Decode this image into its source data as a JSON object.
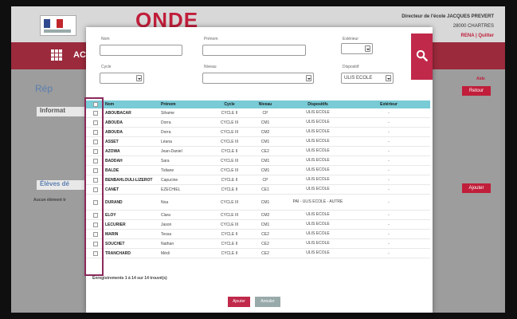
{
  "header": {
    "app_title": "ONDE",
    "director": "Directeur de l'école JACQUES PREVERT",
    "city": "28000 CHARTRES",
    "user_links": "RENA | Quitter"
  },
  "nav": {
    "label": "AC"
  },
  "background": {
    "section_title": "Rép",
    "info_title": "Informat",
    "students_title": "Élèves dé",
    "none_text": "Aucun élément tr",
    "help": "Aide",
    "back_button": "Retour",
    "add_button": "Ajouter"
  },
  "search": {
    "nom_label": "Nom",
    "nom_value": "",
    "prenom_label": "Prénom",
    "prenom_value": "",
    "exterieur_label": "Extérieur",
    "exterieur_value": "",
    "cycle_label": "Cycle",
    "cycle_value": "",
    "niveau_label": "Niveau",
    "niveau_value": "",
    "dispositif_label": "Dispositif",
    "dispositif_value": "ULIS ECOLE"
  },
  "table": {
    "headers": {
      "nom": "Nom",
      "prenom": "Prénom",
      "cycle": "Cycle",
      "niveau": "Niveau",
      "dispositifs": "Dispositifs",
      "exterieur": "Extérieur"
    },
    "rows": [
      {
        "nom": "ABOUBACAR",
        "prenom": "Sihame",
        "cycle": "CYCLE II",
        "niveau": "CP",
        "dispositifs": "ULIS ECOLE",
        "exterieur": "-"
      },
      {
        "nom": "ABOUDA",
        "prenom": "Dorra",
        "cycle": "CYCLE III",
        "niveau": "CM1",
        "dispositifs": "ULIS ECOLE",
        "exterieur": "-"
      },
      {
        "nom": "ABOUDA",
        "prenom": "Dorra",
        "cycle": "CYCLE III",
        "niveau": "CM2",
        "dispositifs": "ULIS ECOLE",
        "exterieur": "-"
      },
      {
        "nom": "ASSET",
        "prenom": "Léana",
        "cycle": "CYCLE III",
        "niveau": "CM1",
        "dispositifs": "ULIS ECOLE",
        "exterieur": "-"
      },
      {
        "nom": "AZOWA",
        "prenom": "Jean-Daniel",
        "cycle": "CYCLE II",
        "niveau": "CE2",
        "dispositifs": "ULIS ECOLE",
        "exterieur": "-"
      },
      {
        "nom": "BADDAH",
        "prenom": "Sara",
        "cycle": "CYCLE III",
        "niveau": "CM1",
        "dispositifs": "ULIS ECOLE",
        "exterieur": "-"
      },
      {
        "nom": "BALDE",
        "prenom": "Tidiane",
        "cycle": "CYCLE III",
        "niveau": "CM1",
        "dispositifs": "ULIS ECOLE",
        "exterieur": "-"
      },
      {
        "nom": "BENBAHLOULI-LIZEROT",
        "prenom": "Capucine",
        "cycle": "CYCLE II",
        "niveau": "CP",
        "dispositifs": "ULIS ECOLE",
        "exterieur": "-"
      },
      {
        "nom": "CANET",
        "prenom": "EZECHIEL",
        "cycle": "CYCLE II",
        "niveau": "CE1",
        "dispositifs": "ULIS ECOLE",
        "exterieur": "-"
      },
      {
        "nom": "DURAND",
        "prenom": "Noa",
        "cycle": "CYCLE III",
        "niveau": "CM1",
        "dispositifs": "PAI - ULIS ECOLE - AUTRE",
        "exterieur": "-"
      },
      {
        "nom": "ELOY",
        "prenom": "Clara",
        "cycle": "CYCLE III",
        "niveau": "CM2",
        "dispositifs": "ULIS ECOLE",
        "exterieur": "-"
      },
      {
        "nom": "LECURIER",
        "prenom": "Jason",
        "cycle": "CYCLE III",
        "niveau": "CM1",
        "dispositifs": "ULIS ECOLE",
        "exterieur": "-"
      },
      {
        "nom": "MARIN",
        "prenom": "Tessa",
        "cycle": "CYCLE II",
        "niveau": "CE2",
        "dispositifs": "ULIS ECOLE",
        "exterieur": "-"
      },
      {
        "nom": "SOUCHET",
        "prenom": "Nathan",
        "cycle": "CYCLE II",
        "niveau": "CE2",
        "dispositifs": "ULIS ECOLE",
        "exterieur": "-"
      },
      {
        "nom": "TRANCHARD",
        "prenom": "Médi",
        "cycle": "CYCLE II",
        "niveau": "CE2",
        "dispositifs": "ULIS ECOLE",
        "exterieur": "-"
      }
    ],
    "count_text": "Enregistrements 1 à 14 sur 14 trouvé(s)"
  },
  "footer": {
    "add_button": "Ajouter",
    "cancel_button": "Annuler"
  },
  "colors": {
    "brand_red": "#c0294a",
    "table_header": "#79cbd6",
    "nav_bar": "#9a2a3c"
  }
}
